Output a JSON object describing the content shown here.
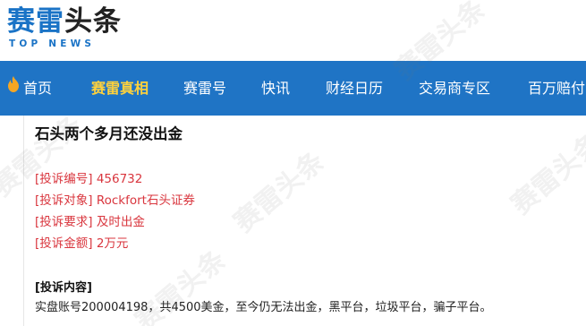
{
  "logo": {
    "cn_part1": "赛雷",
    "cn_part2": "头条",
    "en": "TOP NEWS"
  },
  "nav": {
    "items": [
      {
        "label": "首页",
        "active": false,
        "icon": "flame-icon"
      },
      {
        "label": "赛雷真相",
        "active": true
      },
      {
        "label": "赛雷号",
        "active": false
      },
      {
        "label": "快讯",
        "active": false
      },
      {
        "label": "财经日历",
        "active": false
      },
      {
        "label": "交易商专区",
        "active": false
      },
      {
        "label": "百万赔付",
        "active": false
      }
    ]
  },
  "article": {
    "title": "石头两个多月还没出金",
    "complaint_number": "[投诉编号] 456732",
    "complaint_target": "[投诉对象] Rockfort石头证券",
    "complaint_demand": "[投诉要求] 及时出金",
    "complaint_amount": "[投诉金额] 2万元",
    "content_label": "[投诉内容]",
    "content_text": "实盘账号200004198，共4500美金，至今仍无法出金，黑平台，垃圾平台，骗子平台。"
  },
  "colors": {
    "brand_blue": "#1f74c5",
    "nav_active": "#ffd23c",
    "info_red": "#d9363e",
    "flame_orange": "#f5a623"
  }
}
